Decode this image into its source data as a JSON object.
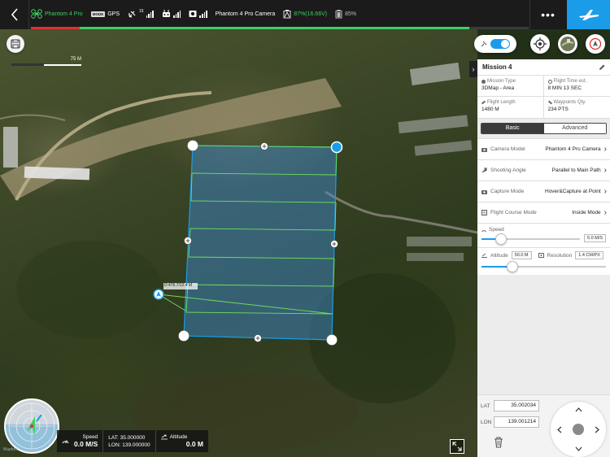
{
  "topbar": {
    "aircraft": "Phantom 4 Pro",
    "gps_label": "GPS",
    "satellite_count": "15",
    "camera": "Phantom 4 Pro Camera",
    "battery_aircraft": "87%(16.66V)",
    "battery_remote": "85%",
    "more_label": "•••",
    "flight_progress": 0.88,
    "colors": {
      "accent": "#1a9ce8",
      "ok": "#3ecf63",
      "warn": "#e03030"
    }
  },
  "map": {
    "scale_label": "75 M",
    "waypoint_tag": "D:476.7/12.4 M",
    "watermark": "Mapbox"
  },
  "telemetry": {
    "speed_label": "Speed",
    "speed_value": "0.0 M/S",
    "lat_label": "LAT: 35.000000",
    "lon_label": "LON: 139.000000",
    "altitude_label": "Altitude",
    "altitude_value": "0.0 M"
  },
  "mission": {
    "title": "Mission 4",
    "info": [
      {
        "label": "Mission Type",
        "value": "3DMap - Area",
        "icon": "globe-icon"
      },
      {
        "label": "Flight Time est.",
        "value": "8 MIN 13 SEC",
        "icon": "clock-icon"
      },
      {
        "label": "Flight Length",
        "value": "1480 M",
        "icon": "ruler-icon"
      },
      {
        "label": "Waypoints Qty.",
        "value": "234 PTS",
        "icon": "waypoint-icon"
      }
    ],
    "tabs": {
      "basic": "Basic",
      "advanced": "Advanced"
    },
    "settings": [
      {
        "label": "Camera Model",
        "value": "Phantom 4 Pro Camera",
        "icon": "camera-icon"
      },
      {
        "label": "Shooting Angle",
        "value": "Parallel to Main Path",
        "icon": "arrow-icon"
      },
      {
        "label": "Capture Mode",
        "value": "Hover&Capture at Point",
        "icon": "camera-icon"
      },
      {
        "label": "Flight Course Mode",
        "value": "Inside Mode",
        "icon": "course-icon"
      }
    ],
    "speed": {
      "label": "Speed",
      "value": "5.0 M/S",
      "fraction": 0.2
    },
    "altitude": {
      "label": "Altitude",
      "value": "50.0 M",
      "fraction": 0.25
    },
    "resolution": {
      "label": "Resolution",
      "value": "1.4 CM/PX"
    }
  },
  "coords": {
    "lat_label": "LAT",
    "lat_value": "35.002034",
    "lon_label": "LON",
    "lon_value": "139.001214"
  }
}
